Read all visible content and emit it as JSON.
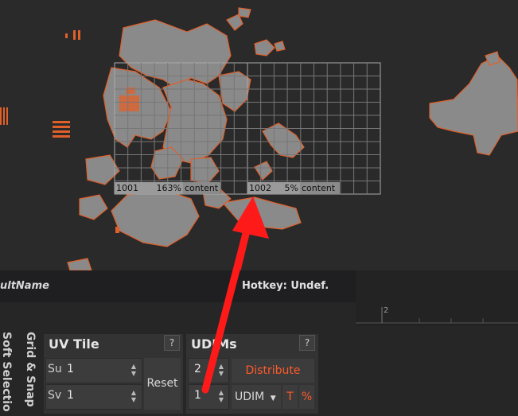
{
  "viewport": {
    "tiles": [
      {
        "id": "1001",
        "percent": "163%",
        "label": "content"
      },
      {
        "id": "1002",
        "percent": "5%",
        "label": "content"
      }
    ],
    "ruler_tick": "2"
  },
  "status": {
    "name": "ultName",
    "hotkey": "Hotkey: Undef."
  },
  "side_tabs": {
    "soft_selection": "Soft Selectio",
    "grid_snap": "Grid & Snap"
  },
  "uv_tile": {
    "title": "UV Tile",
    "help": "?",
    "su_label": "Su",
    "su_value": "1",
    "sv_label": "Sv",
    "sv_value": "1",
    "reset_label": "Reset"
  },
  "udims": {
    "title": "UDIMs",
    "help": "?",
    "count_value": "2",
    "distribute_label": "Distribute",
    "second_value": "1",
    "mode_value": "UDIM",
    "t_label": "T",
    "percent_label": "%"
  },
  "colors": {
    "accent": "#ff5a2a",
    "arrow": "#ff1a1a",
    "island_fill": "#8a8a8a"
  }
}
